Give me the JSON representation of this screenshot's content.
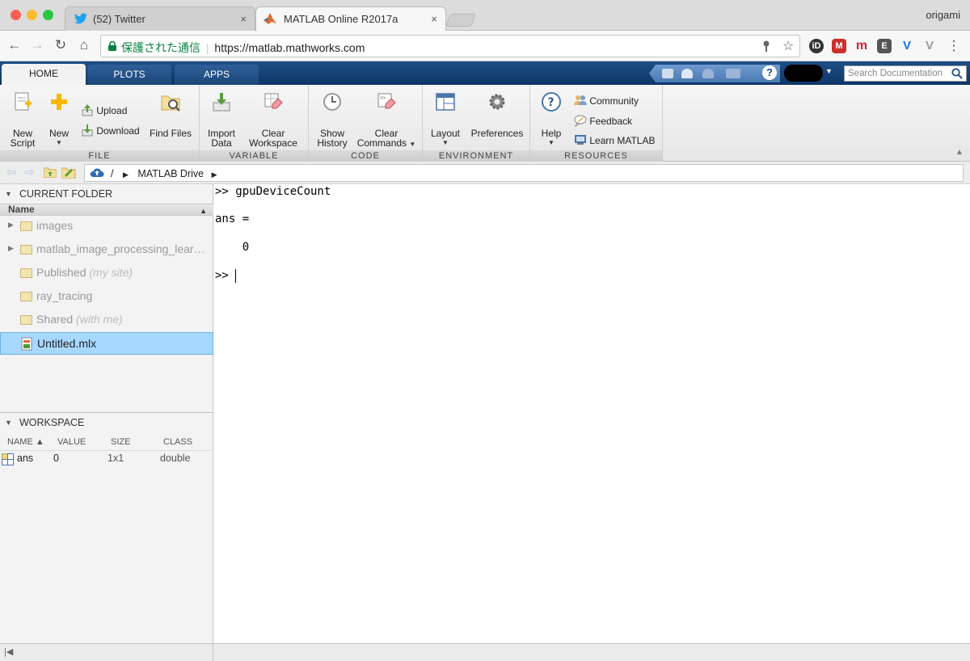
{
  "browser": {
    "tabs": [
      {
        "label": "(52) Twitter",
        "close": "×"
      },
      {
        "label": "MATLAB Online R2017a",
        "close": "×"
      }
    ],
    "user": "origami",
    "secure_label": "保護された通信",
    "url": "https://matlab.mathworks.com",
    "nav": {
      "back": "←",
      "forward": "→",
      "reload": "↻",
      "home": "⌂",
      "star": "☆",
      "menu": "⋮"
    }
  },
  "ribbon": {
    "tabs": [
      "HOME",
      "PLOTS",
      "APPS"
    ],
    "search_placeholder": "Search Documentation",
    "sections": {
      "file": "FILE",
      "variable": "VARIABLE",
      "code": "CODE",
      "environment": "ENVIRONMENT",
      "resources": "RESOURCES"
    },
    "buttons": {
      "new_script": "New\nScript",
      "new_script_l1": "New",
      "new_script_l2": "Script",
      "new": "New",
      "upload": "Upload",
      "download": "Download",
      "find_files": "Find Files",
      "import_l1": "Import",
      "import_l2": "Data",
      "clear_ws_l1": "Clear",
      "clear_ws_l2": "Workspace",
      "show_hist_l1": "Show",
      "show_hist_l2": "History",
      "clear_cmd_l1": "Clear",
      "clear_cmd_l2": "Commands",
      "layout": "Layout",
      "preferences": "Preferences",
      "help": "Help",
      "community": "Community",
      "feedback": "Feedback",
      "learn_matlab": "Learn MATLAB"
    }
  },
  "path": {
    "root": "/",
    "folder": "MATLAB Drive"
  },
  "current_folder": {
    "title": "CURRENT FOLDER",
    "column": "Name",
    "items": [
      {
        "name": "images",
        "suffix": ""
      },
      {
        "name": "matlab_image_processing_lear…",
        "suffix": ""
      },
      {
        "name": "Published",
        "suffix": "(my site)"
      },
      {
        "name": "ray_tracing",
        "suffix": ""
      },
      {
        "name": "Shared",
        "suffix": "(with me)"
      },
      {
        "name": "Untitled.mlx",
        "suffix": ""
      }
    ]
  },
  "workspace": {
    "title": "WORKSPACE",
    "columns": [
      "NAME ▲",
      "VALUE",
      "SIZE",
      "CLASS"
    ],
    "rows": [
      {
        "name": "ans",
        "value": "0",
        "size": "1x1",
        "class": "double"
      }
    ]
  },
  "command_window": {
    "lines": [
      ">> gpuDeviceCount",
      "ans =",
      "    0",
      ">> "
    ]
  }
}
